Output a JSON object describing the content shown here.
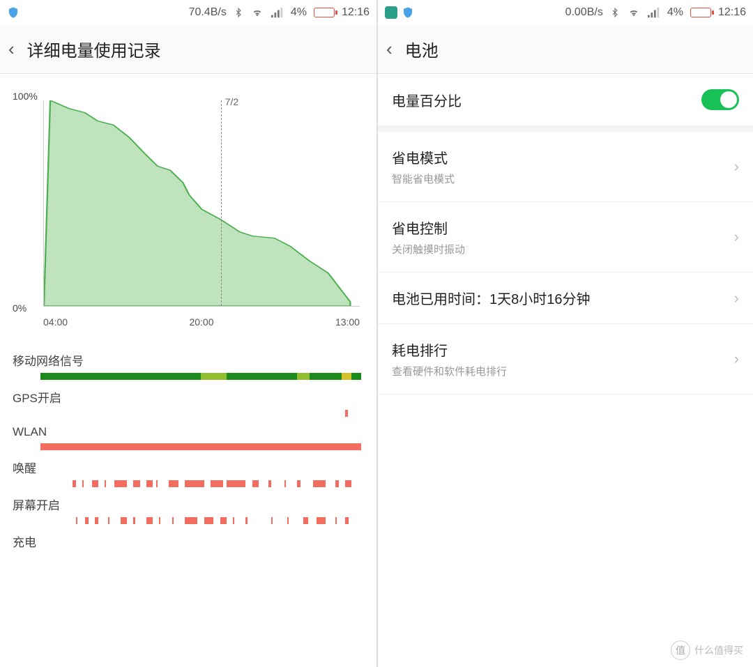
{
  "left_screen": {
    "status": {
      "net_speed": "70.4B/s",
      "battery_pct": "4%",
      "time": "12:16"
    },
    "header": {
      "title": "详细电量使用记录"
    },
    "chart_data": {
      "type": "area",
      "title": "",
      "xlabel": "",
      "ylabel": "",
      "y_top_label": "100%",
      "y_bot_label": "0%",
      "ylim": [
        0,
        100
      ],
      "x_ticks": [
        "04:00",
        "20:00",
        "13:00"
      ],
      "date_marker": {
        "label": "7/2",
        "x_frac": 0.56
      },
      "series": [
        {
          "name": "battery",
          "points": [
            {
              "x_frac": 0.0,
              "y": 0
            },
            {
              "x_frac": 0.02,
              "y": 100
            },
            {
              "x_frac": 0.08,
              "y": 96
            },
            {
              "x_frac": 0.13,
              "y": 94
            },
            {
              "x_frac": 0.17,
              "y": 90
            },
            {
              "x_frac": 0.22,
              "y": 88
            },
            {
              "x_frac": 0.27,
              "y": 82
            },
            {
              "x_frac": 0.32,
              "y": 74
            },
            {
              "x_frac": 0.36,
              "y": 68
            },
            {
              "x_frac": 0.4,
              "y": 66
            },
            {
              "x_frac": 0.44,
              "y": 60
            },
            {
              "x_frac": 0.46,
              "y": 54
            },
            {
              "x_frac": 0.5,
              "y": 47
            },
            {
              "x_frac": 0.56,
              "y": 42
            },
            {
              "x_frac": 0.62,
              "y": 36
            },
            {
              "x_frac": 0.66,
              "y": 34
            },
            {
              "x_frac": 0.73,
              "y": 33
            },
            {
              "x_frac": 0.78,
              "y": 29
            },
            {
              "x_frac": 0.84,
              "y": 22
            },
            {
              "x_frac": 0.9,
              "y": 16
            },
            {
              "x_frac": 0.95,
              "y": 6
            },
            {
              "x_frac": 0.97,
              "y": 2
            },
            {
              "x_frac": 0.97,
              "y": 0
            }
          ]
        }
      ]
    },
    "strips": [
      {
        "key": "mobile_signal",
        "label": "移动网络信号",
        "style": "mixed-green",
        "segments": [
          {
            "l": 0,
            "w": 0.5,
            "c": "g"
          },
          {
            "l": 0.5,
            "w": 0.08,
            "c": "yg"
          },
          {
            "l": 0.58,
            "w": 0.22,
            "c": "g"
          },
          {
            "l": 0.8,
            "w": 0.04,
            "c": "yg"
          },
          {
            "l": 0.84,
            "w": 0.1,
            "c": "g"
          },
          {
            "l": 0.94,
            "w": 0.03,
            "c": "y"
          },
          {
            "l": 0.97,
            "w": 0.03,
            "c": "g"
          }
        ]
      },
      {
        "key": "gps",
        "label": "GPS开启",
        "segments": [
          {
            "l": 0.95,
            "w": 0.008,
            "c": "r"
          }
        ]
      },
      {
        "key": "wlan",
        "label": "WLAN",
        "segments": [
          {
            "l": 0.0,
            "w": 1.0,
            "c": "r"
          }
        ]
      },
      {
        "key": "wake",
        "label": "唤醒",
        "segments": [
          {
            "l": 0.1,
            "w": 0.01,
            "c": "r"
          },
          {
            "l": 0.13,
            "w": 0.005,
            "c": "r"
          },
          {
            "l": 0.16,
            "w": 0.02,
            "c": "r"
          },
          {
            "l": 0.2,
            "w": 0.005,
            "c": "r"
          },
          {
            "l": 0.23,
            "w": 0.04,
            "c": "r"
          },
          {
            "l": 0.29,
            "w": 0.02,
            "c": "r"
          },
          {
            "l": 0.33,
            "w": 0.02,
            "c": "r"
          },
          {
            "l": 0.36,
            "w": 0.005,
            "c": "r"
          },
          {
            "l": 0.4,
            "w": 0.03,
            "c": "r"
          },
          {
            "l": 0.45,
            "w": 0.06,
            "c": "r"
          },
          {
            "l": 0.53,
            "w": 0.04,
            "c": "r"
          },
          {
            "l": 0.58,
            "w": 0.06,
            "c": "r"
          },
          {
            "l": 0.66,
            "w": 0.02,
            "c": "r"
          },
          {
            "l": 0.71,
            "w": 0.01,
            "c": "r"
          },
          {
            "l": 0.76,
            "w": 0.005,
            "c": "r"
          },
          {
            "l": 0.8,
            "w": 0.01,
            "c": "r"
          },
          {
            "l": 0.85,
            "w": 0.04,
            "c": "r"
          },
          {
            "l": 0.92,
            "w": 0.01,
            "c": "r"
          },
          {
            "l": 0.95,
            "w": 0.02,
            "c": "r"
          }
        ]
      },
      {
        "key": "screen",
        "label": "屏幕开启",
        "segments": [
          {
            "l": 0.11,
            "w": 0.005,
            "c": "r"
          },
          {
            "l": 0.14,
            "w": 0.01,
            "c": "r"
          },
          {
            "l": 0.17,
            "w": 0.01,
            "c": "r"
          },
          {
            "l": 0.21,
            "w": 0.005,
            "c": "r"
          },
          {
            "l": 0.25,
            "w": 0.02,
            "c": "r"
          },
          {
            "l": 0.29,
            "w": 0.005,
            "c": "r"
          },
          {
            "l": 0.33,
            "w": 0.02,
            "c": "r"
          },
          {
            "l": 0.37,
            "w": 0.005,
            "c": "r"
          },
          {
            "l": 0.41,
            "w": 0.005,
            "c": "r"
          },
          {
            "l": 0.45,
            "w": 0.04,
            "c": "r"
          },
          {
            "l": 0.51,
            "w": 0.03,
            "c": "r"
          },
          {
            "l": 0.56,
            "w": 0.02,
            "c": "r"
          },
          {
            "l": 0.6,
            "w": 0.005,
            "c": "r"
          },
          {
            "l": 0.64,
            "w": 0.005,
            "c": "r"
          },
          {
            "l": 0.72,
            "w": 0.005,
            "c": "r"
          },
          {
            "l": 0.77,
            "w": 0.005,
            "c": "r"
          },
          {
            "l": 0.82,
            "w": 0.015,
            "c": "r"
          },
          {
            "l": 0.86,
            "w": 0.03,
            "c": "r"
          },
          {
            "l": 0.92,
            "w": 0.005,
            "c": "r"
          },
          {
            "l": 0.95,
            "w": 0.01,
            "c": "r"
          }
        ]
      },
      {
        "key": "charging",
        "label": "充电",
        "segments": []
      }
    ]
  },
  "right_screen": {
    "status": {
      "net_speed": "0.00B/s",
      "battery_pct": "4%",
      "time": "12:16"
    },
    "header": {
      "title": "电池"
    },
    "rows": {
      "percent_switch": {
        "label": "电量百分比",
        "on": true
      },
      "power_save_mode": {
        "title": "省电模式",
        "sub": "智能省电模式"
      },
      "power_control": {
        "title": "省电控制",
        "sub": "关闭触摸时振动"
      },
      "uptime": {
        "title": "电池已用时间：1天8小时16分钟"
      },
      "drain_rank": {
        "title": "耗电排行",
        "sub": "查看硬件和软件耗电排行"
      }
    }
  },
  "watermark": {
    "badge": "值",
    "text": "什么值得买"
  }
}
